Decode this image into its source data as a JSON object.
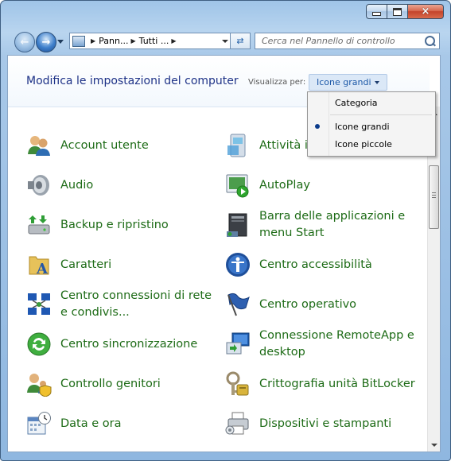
{
  "window": {
    "controls": {
      "minimize": "minimize",
      "maximize": "maximize",
      "close": "×"
    }
  },
  "navigation": {
    "address_crumbs": [
      "Pann...",
      "Tutti ..."
    ],
    "search_placeholder": "Cerca nel Pannello di controllo"
  },
  "header": {
    "title": "Modifica le impostazioni del computer",
    "view_by_label": "Visualizza per:",
    "view_by_value": "Icone grandi"
  },
  "view_menu": {
    "options": [
      "Categoria",
      "Icone grandi",
      "Icone piccole"
    ],
    "selected": "Icone grandi"
  },
  "items": [
    {
      "label": "Account utente",
      "icon": "users-icon"
    },
    {
      "label": "Attività i",
      "icon": "action-center-icon"
    },
    {
      "label": "Audio",
      "icon": "speaker-icon"
    },
    {
      "label": "AutoPlay",
      "icon": "autoplay-icon"
    },
    {
      "label": "Backup e ripristino",
      "icon": "backup-icon"
    },
    {
      "label": "Barra delle applicazioni e menu Start",
      "icon": "taskbar-icon"
    },
    {
      "label": "Caratteri",
      "icon": "fonts-icon"
    },
    {
      "label": "Centro accessibilità",
      "icon": "accessibility-icon"
    },
    {
      "label": "Centro connessioni di rete e condivis...",
      "icon": "network-icon"
    },
    {
      "label": "Centro operativo",
      "icon": "flag-icon"
    },
    {
      "label": "Centro sincronizzazione",
      "icon": "sync-icon"
    },
    {
      "label": "Connessione RemoteApp e desktop",
      "icon": "remoteapp-icon"
    },
    {
      "label": "Controllo genitori",
      "icon": "parental-controls-icon"
    },
    {
      "label": "Crittografia unità BitLocker",
      "icon": "bitlocker-icon"
    },
    {
      "label": "Data e ora",
      "icon": "calendar-clock-icon"
    },
    {
      "label": "Dispositivi e stampanti",
      "icon": "printer-icon"
    }
  ]
}
